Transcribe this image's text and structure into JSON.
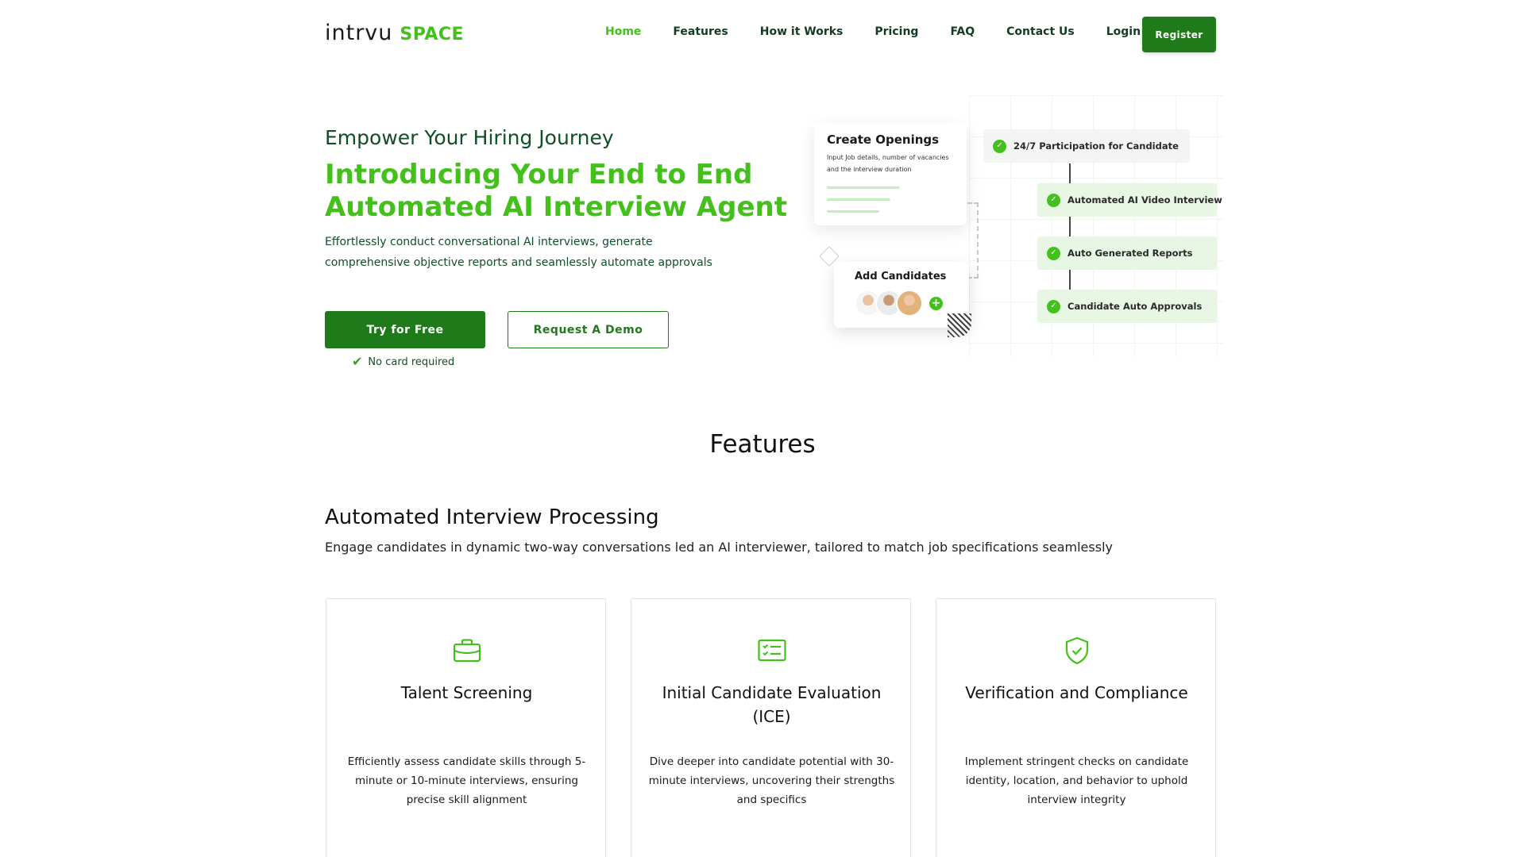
{
  "brand": {
    "main": "intrvu",
    "accent": "SPACE"
  },
  "nav": {
    "items": [
      {
        "label": "Home",
        "active": true
      },
      {
        "label": "Features"
      },
      {
        "label": "How it Works"
      },
      {
        "label": "Pricing"
      },
      {
        "label": "FAQ"
      },
      {
        "label": "Contact Us"
      },
      {
        "label": "Login"
      }
    ],
    "register": "Register"
  },
  "hero": {
    "kicker": "Empower Your Hiring Journey",
    "title": "Introducing Your End to End Automated AI Interview Agent",
    "description": "Effortlessly conduct conversational AI interviews, generate comprehensive objective reports and seamlessly automate approvals",
    "primary_cta": "Try for Free",
    "secondary_cta": "Request A Demo",
    "note": "No card required"
  },
  "graphic": {
    "openings": {
      "title": "Create Openings",
      "subtitle": "Input Job details, number of vacancies and the interview duration"
    },
    "candidates": {
      "title": "Add Candidates"
    },
    "steps": [
      "24/7 Participation for Candidate",
      "Automated AI Video Interview",
      "Auto Generated Reports",
      "Candidate Auto Approvals"
    ]
  },
  "features": {
    "heading": "Features",
    "section_title": "Automated Interview Processing",
    "section_subtitle": "Engage candidates in dynamic two-way conversations led an AI interviewer, tailored to match job specifications seamlessly",
    "cards": [
      {
        "icon": "briefcase-icon",
        "title": "Talent Screening",
        "description": "Efficiently assess candidate skills through 5-minute or 10-minute interviews, ensuring precise skill alignment"
      },
      {
        "icon": "checklist-icon",
        "title": "Initial Candidate Evaluation (ICE)",
        "description": "Dive deeper into candidate potential with 30-minute interviews, uncovering their strengths and specifics"
      },
      {
        "icon": "shield-check-icon",
        "title": "Verification and Compliance",
        "description": "Implement stringent checks on candidate identity, location, and behavior to uphold interview integrity"
      }
    ]
  },
  "colors": {
    "accent_green": "#43c01c",
    "dark_green": "#1f7a1a",
    "text_green": "#0f4f27"
  }
}
